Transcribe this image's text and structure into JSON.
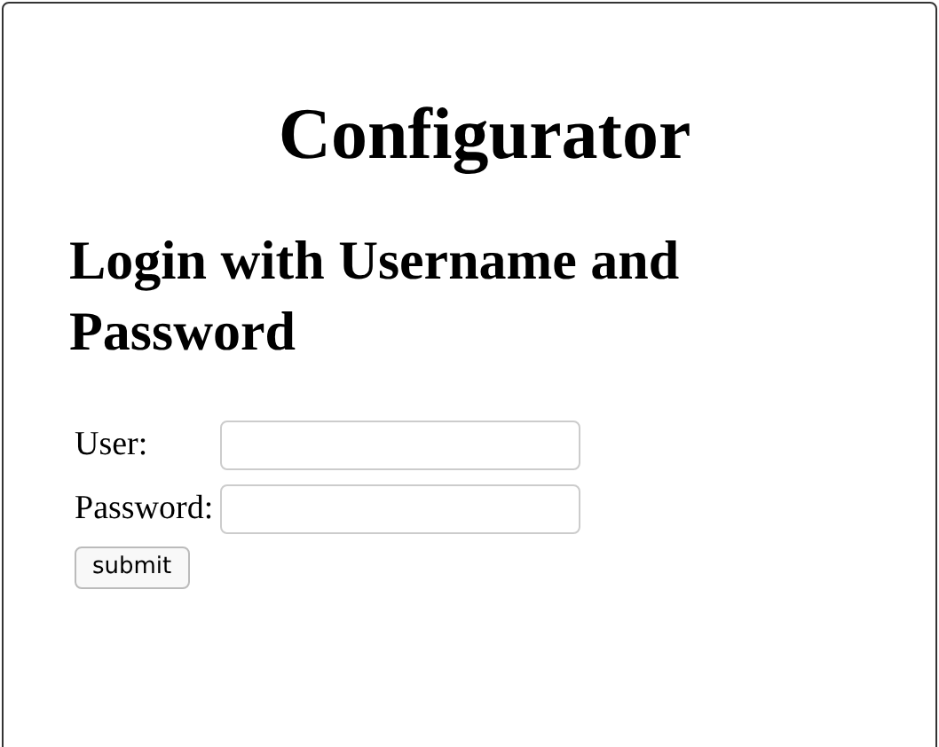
{
  "title": "Configurator",
  "heading": "Login with Username and Password",
  "fields": [
    {
      "label": "User:"
    },
    {
      "label": "Password:"
    }
  ],
  "submit": "submit"
}
